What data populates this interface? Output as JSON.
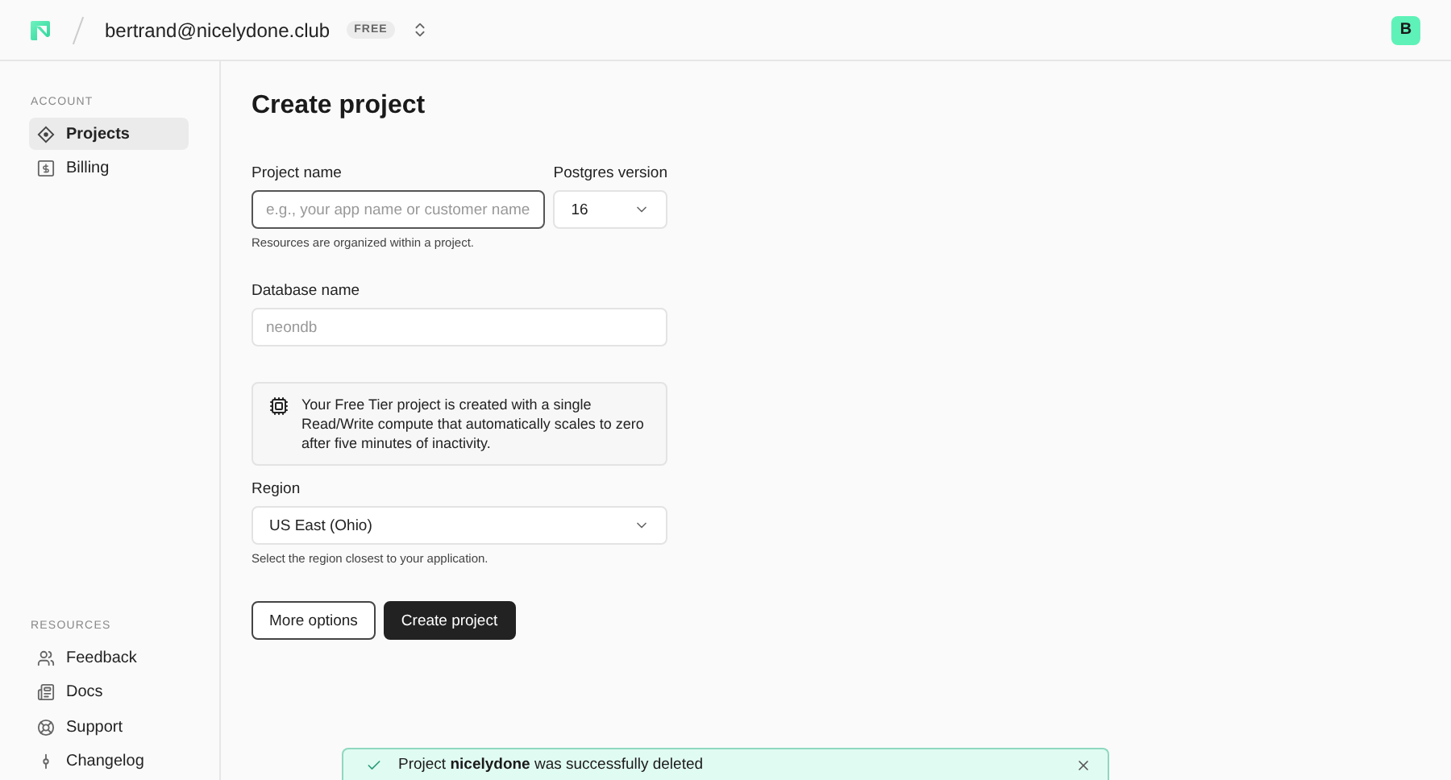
{
  "header": {
    "account": "bertrand@nicelydone.club",
    "plan_badge": "FREE",
    "avatar": "B"
  },
  "sidebar": {
    "sections": [
      {
        "heading": "ACCOUNT",
        "items": [
          {
            "label": "Projects",
            "selected": true
          },
          {
            "label": "Billing",
            "selected": false
          }
        ]
      },
      {
        "heading": "RESOURCES",
        "items": [
          {
            "label": "Feedback",
            "selected": false
          },
          {
            "label": "Docs",
            "selected": false
          },
          {
            "label": "Support",
            "selected": false
          },
          {
            "label": "Changelog",
            "selected": false
          }
        ]
      }
    ]
  },
  "form": {
    "title": "Create project",
    "project_name": {
      "label": "Project name",
      "placeholder": "e.g., your app name or customer name",
      "hint": "Resources are organized within a project."
    },
    "postgres_version": {
      "label": "Postgres version",
      "value": "16"
    },
    "database_name": {
      "label": "Database name",
      "placeholder": "neondb"
    },
    "notice": "Your Free Tier project is created with a single Read/Write compute that automatically scales to zero after five minutes of inactivity.",
    "region": {
      "label": "Region",
      "value": "US East (Ohio)",
      "hint": "Select the region closest to your application."
    },
    "buttons": [
      {
        "label": "More options",
        "kind": "secondary"
      },
      {
        "label": "Create project",
        "kind": "primary"
      }
    ]
  },
  "toast": {
    "message": "Project **nicelydone** was successfully deleted"
  }
}
